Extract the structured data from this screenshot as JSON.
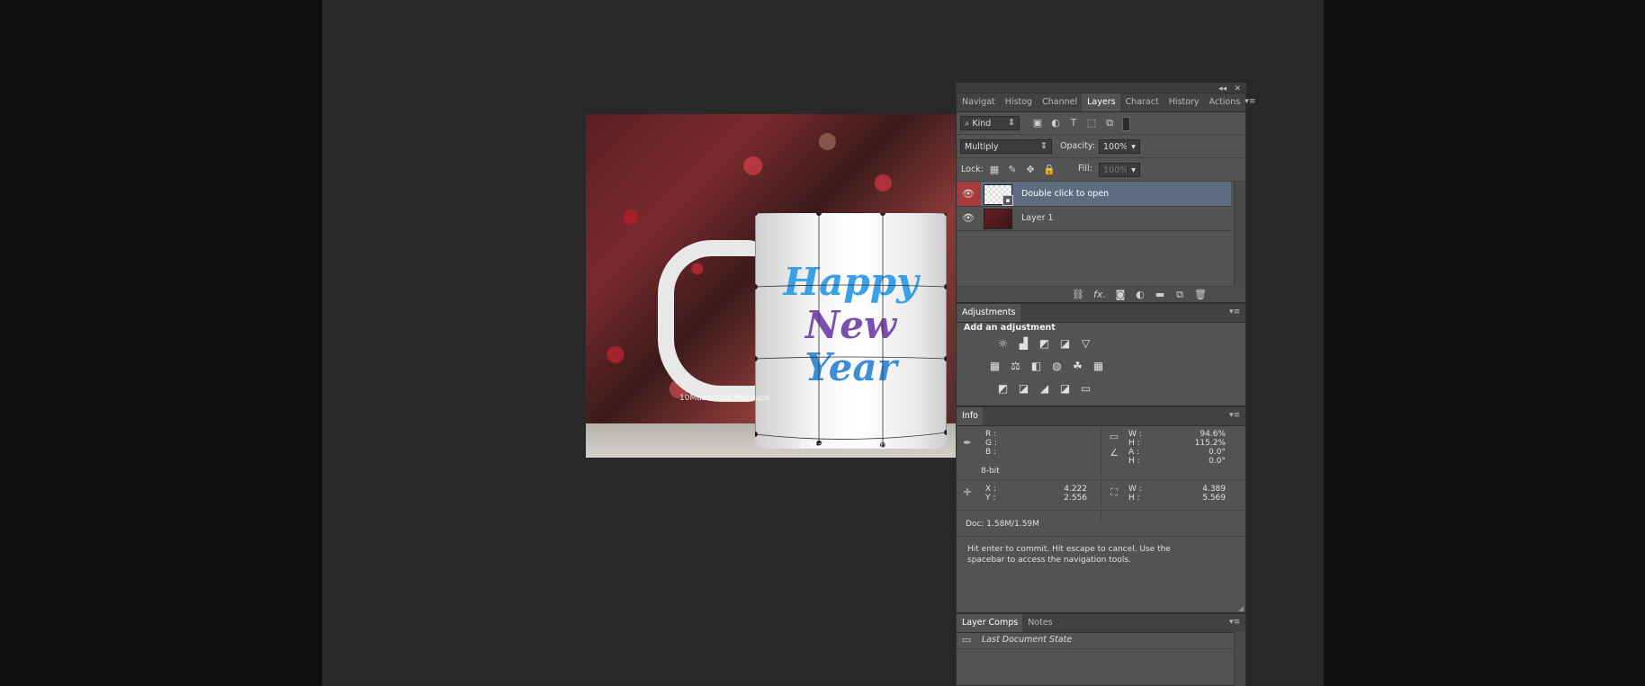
{
  "panel_header": {
    "collapse_glyph": "◂◂",
    "close_glyph": "✕"
  },
  "layers_panel": {
    "tabs": [
      "Navigat",
      "Histog",
      "Channel",
      "Layers",
      "Charact",
      "History",
      "Actions"
    ],
    "active_tab": "Layers",
    "filter_kind": "Kind",
    "blend_mode": "Multiply",
    "opacity_label": "Opacity:",
    "opacity_value": "100%",
    "lock_label": "Lock:",
    "fill_label": "Fill:",
    "fill_value": "100%",
    "layers": [
      {
        "name": "Double click to open",
        "selected": true
      },
      {
        "name": "Layer 1",
        "selected": false
      }
    ],
    "footer_icons": [
      "link-icon",
      "fx-icon",
      "mask-icon",
      "adjustment-icon",
      "folder-icon",
      "new-layer-icon",
      "trash-icon"
    ],
    "fx_glyph": "fx."
  },
  "adjustments_panel": {
    "tab": "Adjustments",
    "heading": "Add an adjustment",
    "rows": [
      [
        "☼",
        "▟",
        "◩",
        "◪",
        "▽"
      ],
      [
        "▦",
        "⚖",
        "◧",
        "◍",
        "☘",
        "▦"
      ],
      [
        "◩",
        "◪",
        "◢",
        "◪",
        "▭"
      ]
    ]
  },
  "info_panel": {
    "tab": "Info",
    "rgb_labels": [
      "R :",
      "G :",
      "B :"
    ],
    "bitdepth": "8-bit",
    "transform": [
      {
        "label": "W :",
        "value": "94.6%"
      },
      {
        "label": "H :",
        "value": "115.2%"
      },
      {
        "label": "A :",
        "value": "0.0°"
      },
      {
        "label": "H :",
        "value": "0.0°"
      }
    ],
    "x_label": "X :",
    "x_value": "4.222",
    "y_label": "Y :",
    "y_value": "2.556",
    "w_label": "W :",
    "w_value": "4.389",
    "h_label": "H :",
    "h_value": "5.569",
    "doc": "Doc: 1.58M/1.59M",
    "hint": "Hit enter to commit. Hit escape to cancel. Use the spacebar to access the navigation tools."
  },
  "layer_comps_panel": {
    "tabs": [
      "Layer Comps",
      "Notes"
    ],
    "item": "Last Document State"
  },
  "canvas": {
    "mug_line1": "Happy",
    "mug_line2": "New",
    "mug_line3": "Year",
    "watermark_1": "10Mazzzzzzz Mockups",
    "watermark_2": "10Mazzzzzzz Mockups"
  }
}
